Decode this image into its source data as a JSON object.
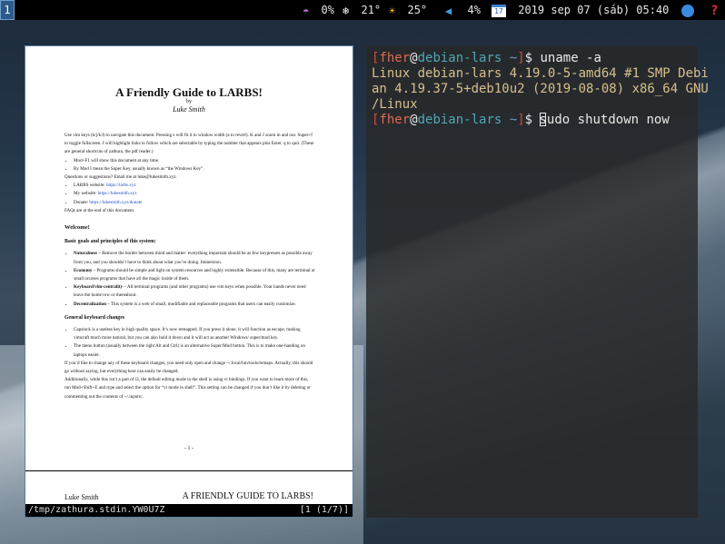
{
  "topbar": {
    "workspace": "1",
    "items": [
      {
        "icon": "umbrella-icon",
        "glyph": "☂",
        "value": "0%",
        "color": "#b070d0"
      },
      {
        "icon": "snowflake-icon",
        "glyph": "❄",
        "value": "21°",
        "color": "#ffffff"
      },
      {
        "icon": "sun-icon",
        "glyph": "☀",
        "value": "25°",
        "color": "#f4b41a"
      },
      {
        "icon": "volume-icon",
        "glyph": "◀",
        "value": "4%",
        "color": "#3aa0e0"
      },
      {
        "icon": "calendar-icon",
        "glyph": "17",
        "value": "2019 sep 07 (sáb) 05:40",
        "color": "#ffffff"
      },
      {
        "icon": "globe-icon",
        "glyph": "●",
        "value": "",
        "color": "#3a8be0"
      },
      {
        "icon": "help-icon",
        "glyph": "?",
        "value": "",
        "color": "#e03030"
      }
    ]
  },
  "zathura": {
    "doc": {
      "title": "A Friendly Guide to LARBS!",
      "by": "by",
      "author": "Luke Smith",
      "intro": "Use vim keys (h/j/k/l) to navigate this document. Pressing s will fit it to window width (a to revert). K and J zoom in and out. Super+f to toggle fullscreen. f will highlight links to follow which are selectable by typing the number that appears plus Enter. q to quit. (These are general shortcuts of zathura, the pdf reader.)",
      "bullets1": [
        "Mod+F1 will show this document at any time.",
        "By Mod I mean the Super Key, usually known as “the Windows Key”."
      ],
      "questions": "Questions or suggestions? Email me at luke@lukesmith.xyz.",
      "links": [
        {
          "label": "LARBS website:",
          "url": "https://larbs.xyz"
        },
        {
          "label": "My website:",
          "url": "https://lukesmith.xyz"
        },
        {
          "label": "Donate:",
          "url": "https://lukesmith.xyz/donate"
        }
      ],
      "faq": "FAQs are at the end of this document.",
      "welcome": "Welcome!",
      "basic_heading": "Basic goals and principles of this system:",
      "principles": [
        {
          "name": "Naturalness",
          "text": "– Remove the border between mind and matter: everything important should be as few keypresses as possible away from you, and you shouldn’t have to think about what you’re doing. Immersion."
        },
        {
          "name": "Economy",
          "text": "– Programs should be simple and light on system resources and highly extensible. Because of this, many are terminal or small ncurses programs that have all the magic inside of them."
        },
        {
          "name": "Keyboard/vim-centrality",
          "text": "– All terminal programs (and other programs) use vim keys when possible. Your hands never need leave the home row or thereabout."
        },
        {
          "name": "Decentralization",
          "text": "– This system is a web of small, modifiable and replaceable programs that users can easily customize."
        }
      ],
      "keyboard_heading": "General keyboard changes",
      "kb_bullets": [
        "Capslock is a useless key in high quality space. It’s now remapped. If you press it alone, it will function as escape, making vimcraft much more natural, but you can also hold it down and it will act as another Windows/ super/mod key.",
        "The menu button (usually between the right Alt and Ctrl) is an alternative Super/Mod button. This is to make one-handing on laptops easier."
      ],
      "kb_para1": "If you’d like to change any of these keyboard changes, you need only open and change ~/.local/bin/tools/remaps. Actually, this should go without saying, but everything here can easily be changed.",
      "kb_para2": "Additionally, while this isn’t a part of i3, the default editing mode in the shell is using vi bindings. If you want to learn more of this, run Mod+Shift+E and type and select the option for “vi mode in shell”. This setting can be changed if you don’t like it by deleting or commenting out the contents of ~/.inputrc.",
      "page_number": "- 1 -",
      "next_header_left": "Luke Smith",
      "next_header_right": "A FRIENDLY GUIDE TO LARBS!"
    },
    "status_left": "/tmp/zathura.stdin.YW0U7Z",
    "status_right": "[1 (1/7)]"
  },
  "terminal": {
    "user": "fher",
    "host": "debian-lars",
    "path": "~",
    "cmd1": "uname -a",
    "output": "Linux debian-lars 4.19.0-5-amd64 #1 SMP Debi\nan 4.19.37-5+deb10u2 (2019-08-08) x86_64 GNU\n/Linux",
    "cmd2_first": "s",
    "cmd2_rest": "udo shutdown now"
  }
}
